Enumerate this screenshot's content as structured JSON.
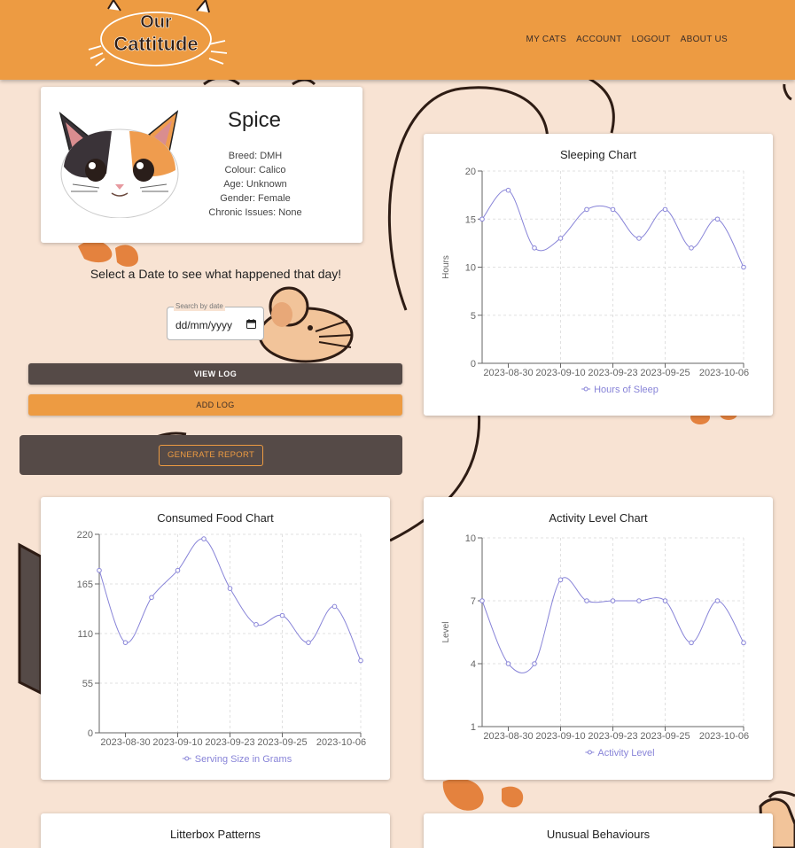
{
  "header": {
    "logo_line1": "Our",
    "logo_line2": "Cattitude",
    "nav": [
      "MY CATS",
      "ACCOUNT",
      "LOGOUT",
      "ABOUT US"
    ]
  },
  "profile": {
    "name": "Spice",
    "breed": "Breed: DMH",
    "colour": "Colour: Calico",
    "age": "Age: Unknown",
    "gender": "Gender: Female",
    "chronic": "Chronic Issues: None"
  },
  "date_prompt": "Select a Date to see what happened that day!",
  "date_picker": {
    "label": "Search by date",
    "placeholder": "dd/mm/yyyy"
  },
  "buttons": {
    "view_log": "VIEW LOG",
    "add_log": "ADD LOG",
    "generate_report": "GENERATE REPORT"
  },
  "sections": {
    "litterbox": "Litterbox Patterns",
    "unusual": "Unusual Behaviours"
  },
  "colors": {
    "header": "#ed9b42",
    "dark": "#554a47",
    "line": "#8884d8",
    "background": "#f8e3d3"
  },
  "chart_data": [
    {
      "id": "sleep",
      "type": "line",
      "title": "Sleeping Chart",
      "ylabel": "Hours",
      "series": [
        {
          "name": "Hours of Sleep",
          "values": [
            15,
            18,
            12,
            13,
            16,
            16,
            13,
            16,
            12,
            15,
            10
          ]
        }
      ],
      "xticks": [
        "2023-08-30",
        "2023-09-10",
        "2023-09-23",
        "2023-09-25",
        "2023-10-06"
      ],
      "yticks": [
        0,
        5,
        10,
        15,
        20
      ],
      "ylim": [
        0,
        20
      ],
      "grid": true,
      "legend": "bottom"
    },
    {
      "id": "food",
      "type": "line",
      "title": "Consumed Food Chart",
      "ylabel": "",
      "series": [
        {
          "name": "Serving Size in Grams",
          "values": [
            180,
            100,
            150,
            180,
            215,
            160,
            120,
            130,
            100,
            140,
            80
          ]
        }
      ],
      "xticks": [
        "2023-08-30",
        "2023-09-10",
        "2023-09-23",
        "2023-09-25",
        "2023-10-06"
      ],
      "yticks": [
        0,
        55,
        110,
        165,
        220
      ],
      "ylim": [
        0,
        220
      ],
      "grid": true,
      "legend": "bottom"
    },
    {
      "id": "activity",
      "type": "line",
      "title": "Activity Level Chart",
      "ylabel": "Level",
      "series": [
        {
          "name": "Activity Level",
          "values": [
            7,
            4,
            4,
            8,
            7,
            7,
            7,
            7,
            5,
            7,
            5
          ]
        }
      ],
      "xticks": [
        "2023-08-30",
        "2023-09-10",
        "2023-09-23",
        "2023-09-25",
        "2023-10-06"
      ],
      "yticks": [
        1,
        4,
        7,
        10
      ],
      "ylim": [
        1,
        10
      ],
      "grid": true,
      "legend": "bottom"
    }
  ]
}
